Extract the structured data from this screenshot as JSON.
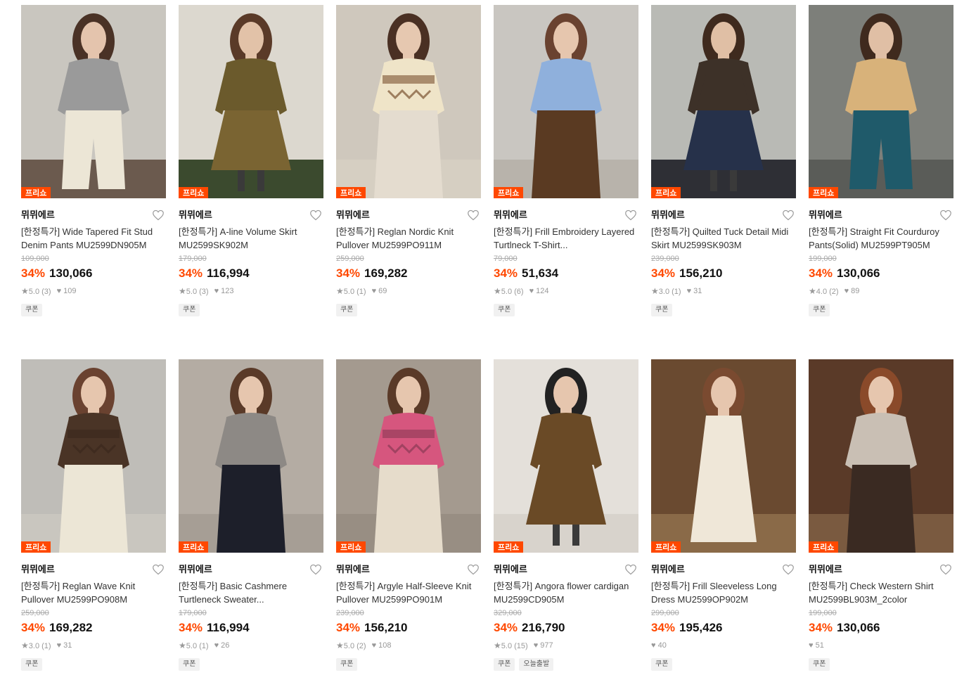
{
  "products": [
    {
      "badge": "프리쇼",
      "brand": "뮈뮈에르",
      "title": "[한정특가] Wide Tapered Fit Stud Denim Pants MU2599DN905M",
      "original_price": "109,000",
      "discount": "34%",
      "price": "130,066",
      "rating": "5.0",
      "reviews": "(3)",
      "likes": "109",
      "tags": [
        "쿠폰"
      ],
      "image": "model-cream-wide-denim-pants"
    },
    {
      "badge": "프리쇼",
      "brand": "뮈뮈에르",
      "title": "[한정특가] A-line Volume Skirt MU2599SK902M",
      "original_price": "179,000",
      "discount": "34%",
      "price": "116,994",
      "rating": "5.0",
      "reviews": "(3)",
      "likes": "123",
      "tags": [
        "쿠폰"
      ],
      "image": "model-olive-aline-skirt"
    },
    {
      "badge": "프리쇼",
      "brand": "뮈뮈에르",
      "title": "[한정특가] Reglan Nordic Knit Pullover MU2599PO911M",
      "original_price": "259,000",
      "discount": "34%",
      "price": "169,282",
      "rating": "5.0",
      "reviews": "(1)",
      "likes": "69",
      "tags": [
        "쿠폰"
      ],
      "image": "model-nordic-knit-pullover"
    },
    {
      "badge": "프리쇼",
      "brand": "뮈뮈에르",
      "title": "[한정특가] Frill Embroidery Layered Turtlneck T-Shirt...",
      "original_price": "79,000",
      "discount": "34%",
      "price": "51,634",
      "rating": "5.0",
      "reviews": "(6)",
      "likes": "124",
      "tags": [
        "쿠폰"
      ],
      "image": "model-blue-turtleneck"
    },
    {
      "badge": "프리쇼",
      "brand": "뮈뮈에르",
      "title": "[한정특가] Quilted Tuck Detail Midi Skirt MU2599SK903M",
      "original_price": "239,000",
      "discount": "34%",
      "price": "156,210",
      "rating": "3.0",
      "reviews": "(1)",
      "likes": "31",
      "tags": [
        "쿠폰"
      ],
      "image": "model-navy-quilted-skirt"
    },
    {
      "badge": "프리쇼",
      "brand": "뮈뮈에르",
      "title": "[한정특가] Straight Fit Courduroy Pants(Solid) MU2599PT905M",
      "original_price": "199,000",
      "discount": "34%",
      "price": "130,066",
      "rating": "4.0",
      "reviews": "(2)",
      "likes": "89",
      "tags": [
        "쿠폰"
      ],
      "image": "model-teal-corduroy-pants"
    },
    {
      "badge": "프리쇼",
      "brand": "뮈뮈에르",
      "title": "[한정특가] Reglan Wave Knit Pullover MU2599PO908M",
      "original_price": "259,000",
      "discount": "34%",
      "price": "169,282",
      "rating": "3.0",
      "reviews": "(1)",
      "likes": "31",
      "tags": [
        "쿠폰"
      ],
      "image": "model-brown-wave-knit"
    },
    {
      "badge": "프리쇼",
      "brand": "뮈뮈에르",
      "title": "[한정특가] Basic Cashmere Turtleneck Sweater...",
      "original_price": "179,000",
      "discount": "34%",
      "price": "116,994",
      "rating": "5.0",
      "reviews": "(1)",
      "likes": "26",
      "tags": [
        "쿠폰"
      ],
      "image": "model-grey-cashmere-turtleneck"
    },
    {
      "badge": "프리쇼",
      "brand": "뮈뮈에르",
      "title": "[한정특가] Argyle Half-Sleeve Knit Pullover MU2599PO901M",
      "original_price": "239,000",
      "discount": "34%",
      "price": "156,210",
      "rating": "5.0",
      "reviews": "(2)",
      "likes": "108",
      "tags": [
        "쿠폰"
      ],
      "image": "model-pink-argyle-knit"
    },
    {
      "badge": "프리쇼",
      "brand": "뮈뮈에르",
      "title": "[한정특가] Angora flower cardigan MU2599CD905M",
      "original_price": "329,000",
      "discount": "34%",
      "price": "216,790",
      "rating": "5.0",
      "reviews": "(15)",
      "likes": "977",
      "tags": [
        "쿠폰",
        "오늘출발"
      ],
      "image": "model-brown-angora-cardigan"
    },
    {
      "badge": "프리쇼",
      "brand": "뮈뮈에르",
      "title": "[한정특가] Frill Sleeveless Long Dress MU2599OP902M",
      "original_price": "299,000",
      "discount": "34%",
      "price": "195,426",
      "rating": "",
      "reviews": "",
      "likes": "40",
      "tags": [
        "쿠폰"
      ],
      "image": "model-cream-frill-long-dress"
    },
    {
      "badge": "프리쇼",
      "brand": "뮈뮈에르",
      "title": "[한정특가] Check Western Shirt MU2599BL903M_2color",
      "original_price": "199,000",
      "discount": "34%",
      "price": "130,066",
      "rating": "",
      "reviews": "",
      "likes": "51",
      "tags": [
        "쿠폰"
      ],
      "image": "model-check-western-shirt"
    }
  ],
  "colors": {
    "accent": "#ff4800",
    "text": "#111111",
    "muted": "#999999",
    "strike": "#aaaaaa"
  }
}
